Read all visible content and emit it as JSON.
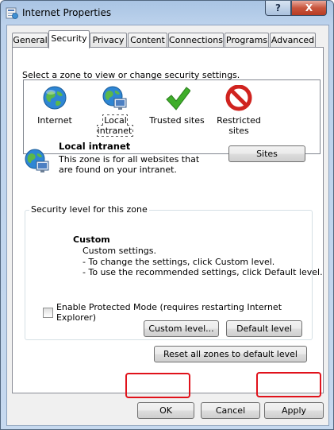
{
  "window": {
    "title": "Internet Properties",
    "help_label": "?",
    "close_label": "X"
  },
  "tabs": [
    {
      "label": "General"
    },
    {
      "label": "Security",
      "active": true
    },
    {
      "label": "Privacy"
    },
    {
      "label": "Content"
    },
    {
      "label": "Connections"
    },
    {
      "label": "Programs"
    },
    {
      "label": "Advanced"
    }
  ],
  "security": {
    "zone_prompt": "Select a zone to view or change security settings.",
    "zones": [
      {
        "label": "Internet",
        "icon": "globe-icon"
      },
      {
        "label": "Local intranet",
        "icon": "intranet-icon",
        "selected": true
      },
      {
        "label": "Trusted sites",
        "icon": "checkmark-icon"
      },
      {
        "label": "Restricted sites",
        "icon": "restricted-icon"
      }
    ],
    "detail": {
      "title": "Local intranet",
      "description": "This zone is for all websites that are found on your intranet.",
      "sites_button": "Sites"
    },
    "level": {
      "legend": "Security level for this zone",
      "title": "Custom",
      "lines": [
        "Custom settings.",
        "- To change the settings, click Custom level.",
        "- To use the recommended settings, click Default level."
      ]
    },
    "protected_mode": {
      "label": "Enable Protected Mode (requires restarting Internet Explorer)",
      "checked": false
    },
    "custom_level_button": "Custom level...",
    "default_level_button": "Default level",
    "reset_button": "Reset all zones to default level"
  },
  "footer": {
    "ok": "OK",
    "cancel": "Cancel",
    "apply": "Apply"
  },
  "colors": {
    "highlight": "#e0121b",
    "title_bar": "#a9c4e3"
  }
}
